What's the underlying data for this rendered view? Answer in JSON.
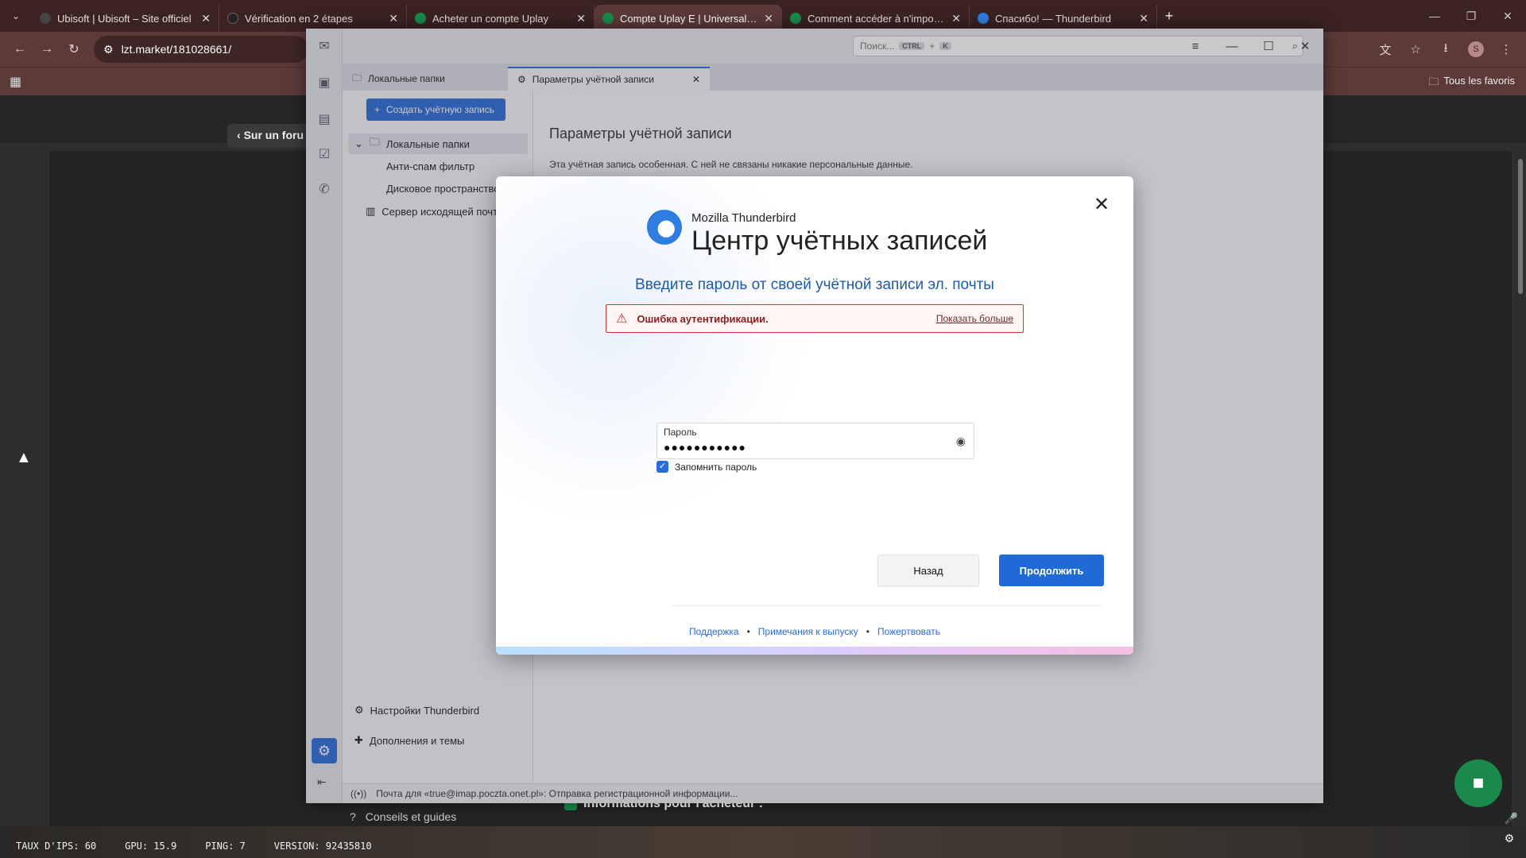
{
  "browser": {
    "tabs": [
      {
        "label": "Ubisoft | Ubisoft – Site officiel",
        "color": "#444444"
      },
      {
        "label": "Vérification en 2 étapes",
        "color": "#222222"
      },
      {
        "label": "Acheter un compte Uplay",
        "color": "#1a8a4c"
      },
      {
        "label": "Compte Uplay E | Universal 1 | A",
        "color": "#1a8a4c"
      },
      {
        "label": "Comment accéder à n'importe",
        "color": "#1a8a4c"
      },
      {
        "label": "Спасибо! — Thunderbird",
        "color": "#2f7de1"
      }
    ],
    "active_tab_index": 3,
    "url": "lzt.market/181028661/",
    "bookmarks_label": "Tous les favoris",
    "avatar_letter": "S"
  },
  "site": {
    "back_label": "Sur un foru",
    "info_label": "Informations pour l'acheteur :",
    "guides_label": "Conseils et guides"
  },
  "hud": {
    "fps": "TAUX D'IPS: 60",
    "gpu": "GPU: 15.9",
    "ping": "PING: 7",
    "version": "VERSION: 92435810"
  },
  "thunderbird": {
    "search_placeholder": "Поиск...",
    "search_kbd1": "CTRL",
    "search_kbd2": "K",
    "tab_folders": "Локальные папки",
    "tab_settings": "Параметры учётной записи",
    "create_account": "Создать учётную запись",
    "tree": {
      "local_folders": "Локальные папки",
      "junk": "Анти-спам фильтр",
      "disk": "Дисковое пространство",
      "smtp": "Сервер исходящей почты"
    },
    "settings_link": "Настройки Thunderbird",
    "addons_link": "Дополнения и темы",
    "main_title": "Параметры учётной записи",
    "main_desc": "Эта учётная запись особенная. С ней не связаны никакие персональные данные.",
    "status": "Почта для «true@imap.poczta.onet.pl»: Отправка регистрационной информации..."
  },
  "dialog": {
    "brand_small": "Mozilla Thunderbird",
    "brand_big": "Центр учётных записей",
    "heading": "Введите пароль от своей учётной записи эл. почты",
    "error_text": "Ошибка аутентификации.",
    "error_more": "Показать больше",
    "password_label": "Пароль",
    "password_value": "●●●●●●●●●●●",
    "remember_label": "Запомнить пароль",
    "remember_checked": true,
    "back_button": "Назад",
    "continue_button": "Продолжить",
    "links": {
      "support": "Поддержка",
      "release_notes": "Примечания к выпуску",
      "donate": "Пожертвовать"
    }
  }
}
